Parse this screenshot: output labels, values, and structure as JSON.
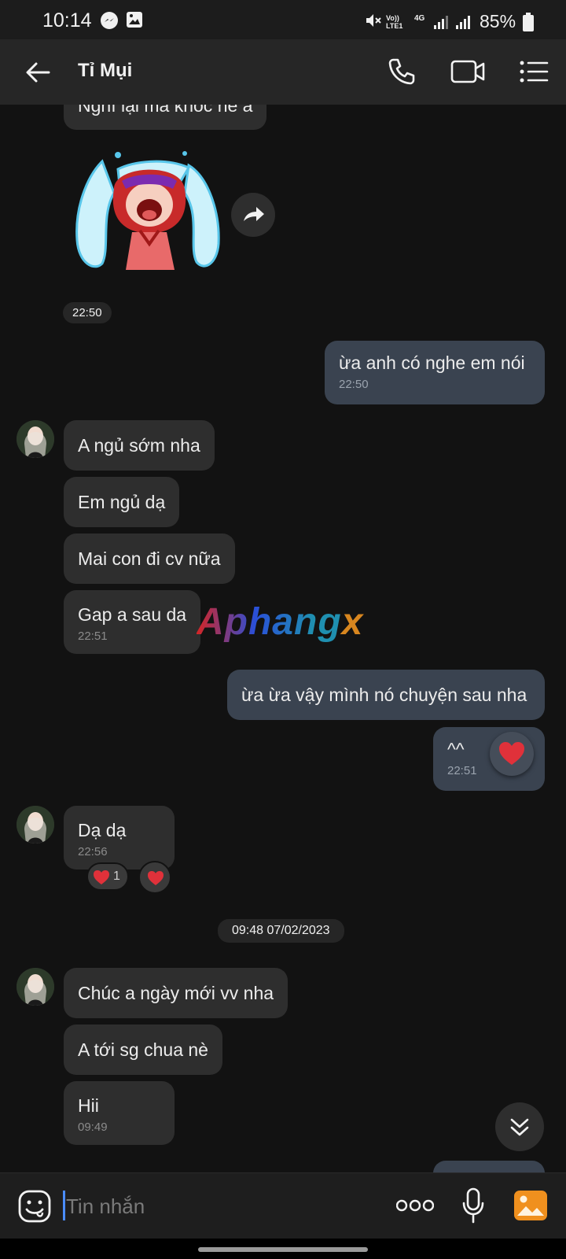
{
  "status_bar": {
    "time": "10:14",
    "battery": "85%",
    "icons": [
      "messenger-icon",
      "gallery-icon",
      "mute-icon",
      "volte-icon",
      "4g-icon",
      "signal-icon",
      "signal-icon",
      "battery-icon"
    ],
    "volte_label": "Vo)) LTE1",
    "network_label": "4G"
  },
  "header": {
    "title": "Tỉ Mụi",
    "icons": [
      "back-arrow-icon",
      "phone-icon",
      "video-call-icon",
      "menu-list-icon"
    ]
  },
  "messages": {
    "top_partial": "Nghĩ lại mà khóc nè a",
    "sticker_time": "22:50",
    "out_1": {
      "text": "ừa anh có nghe em nói",
      "time": "22:50"
    },
    "in_group_1": [
      "A ngủ sớm nha",
      "Em ngủ dạ",
      "Mai con đi cv nữa",
      "Gap a sau da"
    ],
    "in_group_1_time": "22:51",
    "out_2": {
      "text": "ừa ừa vậy mình nó chuyện sau nha"
    },
    "out_3": {
      "text": "^^",
      "time": "22:51"
    },
    "in_2": {
      "text": "Dạ dạ",
      "time": "22:56"
    },
    "reaction_count": "1",
    "date_separator": "09:48 07/02/2023",
    "in_group_2": [
      "Chúc a ngày mới vv nha",
      "A tới sg chua nè",
      "Hii"
    ],
    "in_group_2_time": "09:49"
  },
  "watermark": {
    "text_part1": "Aphang",
    "text_part2": "x"
  },
  "input": {
    "placeholder": "Tin nhắn"
  },
  "colors": {
    "background": "#121212",
    "header": "#262626",
    "incoming_bubble": "#2e2e2e",
    "outgoing_bubble": "#3a4350",
    "heart": "#e0313a",
    "accent_blue": "#4a8cff",
    "gallery_orange": "#f0901e"
  }
}
